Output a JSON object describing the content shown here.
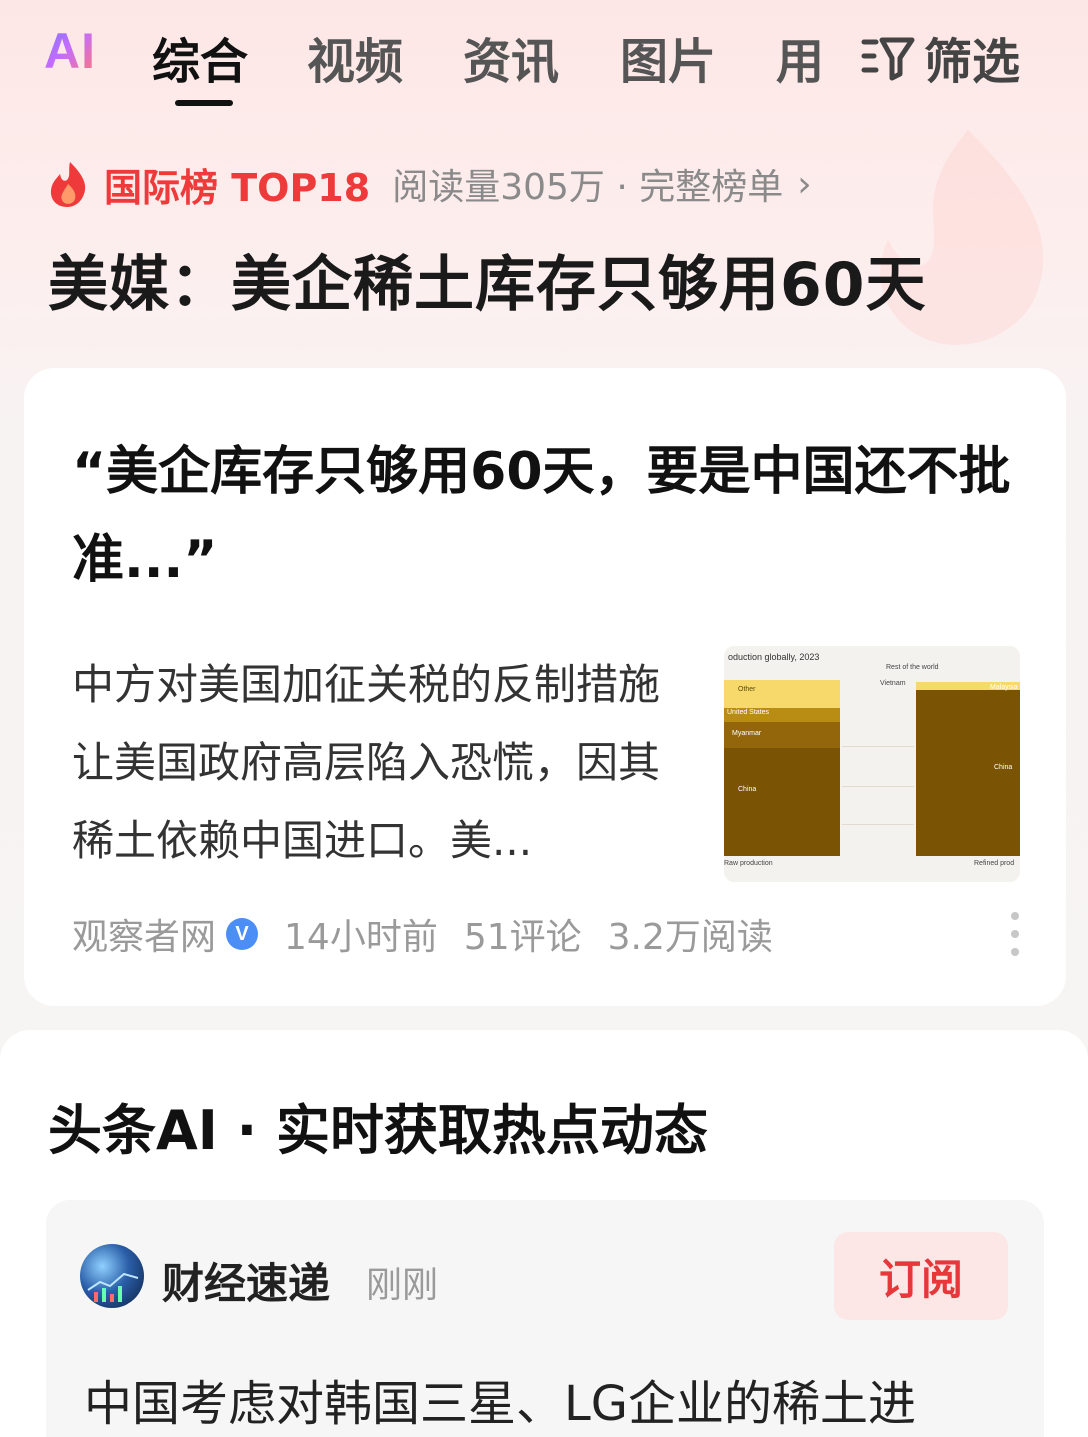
{
  "topbar": {
    "logo": "AI",
    "tabs": [
      "综合",
      "视频",
      "资讯",
      "图片",
      "用"
    ],
    "active_tab": "综合",
    "filter_label": "筛选"
  },
  "ranking": {
    "badge": "国际榜 TOP18",
    "meta": "阅读量305万 · 完整榜单",
    "chevron": "›",
    "headline": "美媒：美企稀土库存只够用60天"
  },
  "card1": {
    "title": "“美企库存只够用60天，要是中国还不批准...”",
    "summary": "中方对美国加征关税的反制措施让美国政府高层陷入恐慌，因其稀土依赖中国进口。美...",
    "thumbnail": {
      "title": "oduction globally, 2023",
      "labels": {
        "other": "Other",
        "us": "United States",
        "myanmar": "Myanmar",
        "china_left": "China",
        "rest": "Rest of the world",
        "vietnam": "Vietnam",
        "malaysia": "Malaysia",
        "china_right": "China",
        "x_left": "Raw production",
        "x_right": "Refined prod"
      }
    },
    "source": "观察者网",
    "verified": "V",
    "time": "14小时前",
    "comments": "51评论",
    "reads": "3.2万阅读"
  },
  "card2": {
    "title": "头条AI · 实时获取热点动态",
    "source_name": "财经速递",
    "source_time": "刚刚",
    "subscribe_label": "订阅",
    "snippet": "中国考虑对韩国三星、LG企业的稀土进"
  },
  "colors": {
    "accent_red": "#ee3a3a",
    "subscribe_bg": "#fde6e6",
    "verified_blue": "#4b8ef5"
  }
}
